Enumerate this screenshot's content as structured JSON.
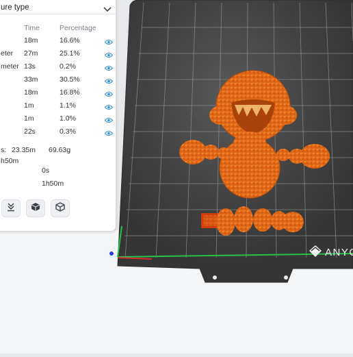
{
  "panel": {
    "dropdown_label": "ure type",
    "header": {
      "time": "Time",
      "percentage": "Percentage"
    },
    "rows": [
      {
        "name": "",
        "time": "18m",
        "percentage": "16.6%"
      },
      {
        "name": "eter",
        "time": "27m",
        "percentage": "25.1%"
      },
      {
        "name": "meter",
        "time": "13s",
        "percentage": "0.2%"
      },
      {
        "name": "",
        "time": "33m",
        "percentage": "30.5%"
      },
      {
        "name": "",
        "time": "18m",
        "percentage": "16.8%"
      },
      {
        "name": "",
        "time": "1m",
        "percentage": "1.1%"
      },
      {
        "name": "",
        "time": "1m",
        "percentage": "1.0%"
      },
      {
        "name": "",
        "time": "22s",
        "percentage": "0.3%"
      }
    ],
    "totals": {
      "label": "s:",
      "filament_length": "23.35m",
      "filament_weight": "69.63g",
      "time_a": "h50m",
      "time_b": "0s",
      "time_c": "1h50m"
    }
  },
  "plate": {
    "brand": "ANYC",
    "color": "#3c3c3c"
  },
  "model": {
    "color": "#e9691e"
  },
  "icons": [
    "chevron-down-icon",
    "eye-icon",
    "layer-down-icon",
    "cube-solid-icon",
    "cube-outline-icon",
    "anycubic-logo-icon"
  ]
}
